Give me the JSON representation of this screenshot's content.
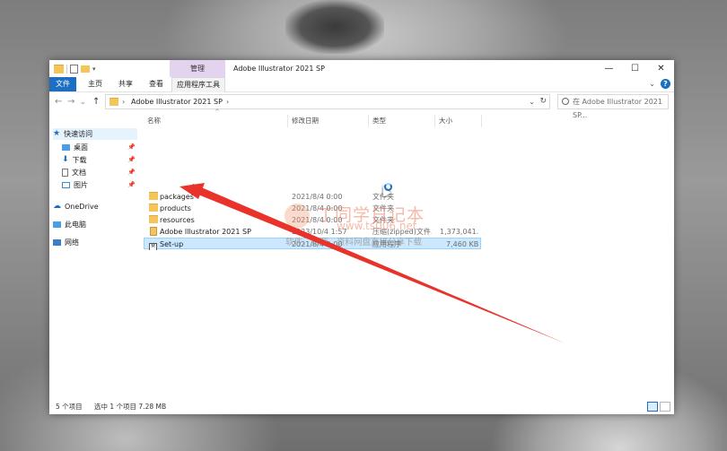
{
  "window": {
    "title": "Adobe Illustrator 2021 SP",
    "context_tab": "管理",
    "controls": {
      "minimize": "—",
      "maximize": "☐",
      "close": "✕"
    }
  },
  "ribbon": {
    "tabs": [
      "文件",
      "主页",
      "共享",
      "查看",
      "应用程序工具"
    ],
    "help": "?"
  },
  "address": {
    "back": "←",
    "forward": "→",
    "recent": "⌄",
    "up": "↑",
    "path": "Adobe Illustrator 2021 SP",
    "search_placeholder": "在 Adobe Illustrator 2021 SP...",
    "refresh": "↻"
  },
  "sidebar": {
    "items": [
      {
        "label": "快速访问"
      },
      {
        "label": "桌面",
        "pinned": true
      },
      {
        "label": "下载",
        "pinned": true
      },
      {
        "label": "文档",
        "pinned": true
      },
      {
        "label": "图片",
        "pinned": true
      },
      {
        "label": "OneDrive"
      },
      {
        "label": "此电脑"
      },
      {
        "label": "网络"
      }
    ]
  },
  "columns": {
    "name": "名称",
    "modified": "修改日期",
    "type": "类型",
    "size": "大小"
  },
  "files": [
    {
      "name": "packages",
      "modified": "2021/8/4 0:00",
      "type": "文件夹",
      "size": "",
      "icon": "folder-icon"
    },
    {
      "name": "products",
      "modified": "2021/8/4 0:00",
      "type": "文件夹",
      "size": "",
      "icon": "folder-icon"
    },
    {
      "name": "resources",
      "modified": "2021/8/4 0:00",
      "type": "文件夹",
      "size": "",
      "icon": "folder-icon"
    },
    {
      "name": "Adobe Illustrator 2021 SP",
      "modified": "2023/10/4 1:57",
      "type": "压缩(zipped)文件...",
      "size": "1,373,041...",
      "icon": "zip-icon"
    },
    {
      "name": "Set-up",
      "modified": "2021/8/4 0:00",
      "type": "应用程序",
      "size": "7,460 KB",
      "icon": "exe-icon",
      "selected": true
    }
  ],
  "status": {
    "count": "5 个项目",
    "selection": "选中 1 个项目  7.28 MB"
  },
  "watermark": {
    "title": "丁同学日记本",
    "url": "www.ts006.net",
    "subtitle": "软件、资源、资料网盘直接分享下载"
  },
  "colors": {
    "accent": "#1b6ec1",
    "selection": "#cce8ff",
    "arrow": "#e8322a",
    "manage_tab": "#e4d3ef"
  }
}
